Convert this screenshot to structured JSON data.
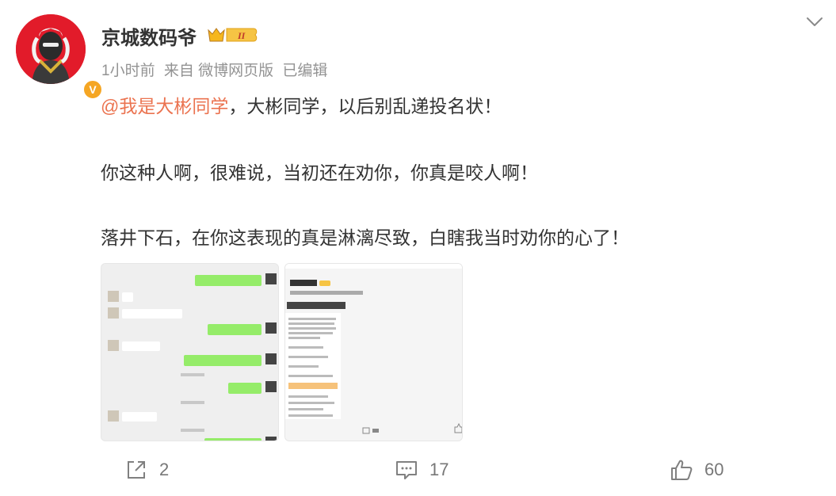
{
  "post": {
    "username": "京城数码爷",
    "vip_level": "II",
    "verified_badge": "V",
    "meta": {
      "time": "1小时前",
      "source": "来自 微博网页版",
      "edited": "已编辑"
    },
    "mention": "@我是大彬同学",
    "lines": [
      "，大彬同学，以后别乱递投名状！",
      "你这种人啊，很难说，当初还在劝你，你真是咬人啊！",
      "落井下石，在你这表现的真是淋漓尽致，白瞎我当时劝你的心了！"
    ]
  },
  "images": [
    {
      "name": "chat-screenshot"
    },
    {
      "name": "weibo-post-screenshot"
    }
  ],
  "actions": {
    "share_count": "2",
    "comment_count": "17",
    "like_count": "60"
  },
  "colors": {
    "mention": "#eb7350",
    "meta": "#939393",
    "avatar_bg": "#e21b2a",
    "verified": "#f5a623"
  }
}
